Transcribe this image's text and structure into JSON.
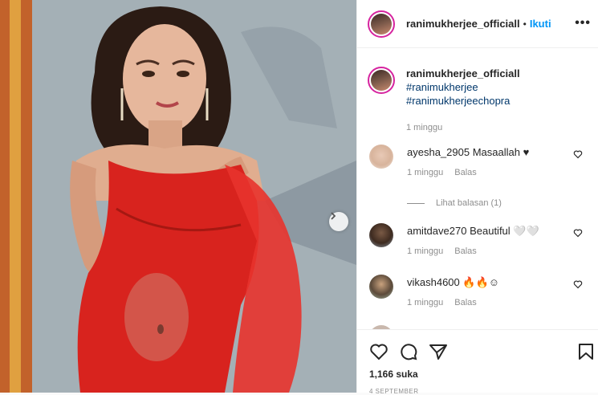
{
  "post": {
    "username": "ranimukherjee_officiall",
    "separator": "•",
    "follow_label": "Ikuti",
    "more_label": "•••"
  },
  "caption": {
    "username": "ranimukherjee_officiall",
    "tags": [
      "#ranimukherjee",
      "#ranimukherjeechopra"
    ],
    "time": "1 minggu"
  },
  "comments": [
    {
      "user": "ayesha_2905",
      "text": "Masaallah ♥",
      "time": "1 minggu",
      "reply": "Balas"
    },
    {
      "user": "amitdave270",
      "text": "Beautiful 🤍🤍",
      "time": "1 minggu",
      "reply": "Balas"
    },
    {
      "user": "vikash4600",
      "text": "🔥🔥☺",
      "time": "1 minggu",
      "reply": "Balas"
    }
  ],
  "view_replies": "Lihat balasan (1)",
  "likes": "1,166 suka",
  "date": "4 SEPTEMBER",
  "icons": {
    "like": "heart-icon",
    "comment": "comment-icon",
    "share": "share-icon",
    "save": "bookmark-icon",
    "next": "chevron-right-icon",
    "more": "more-options-icon"
  }
}
